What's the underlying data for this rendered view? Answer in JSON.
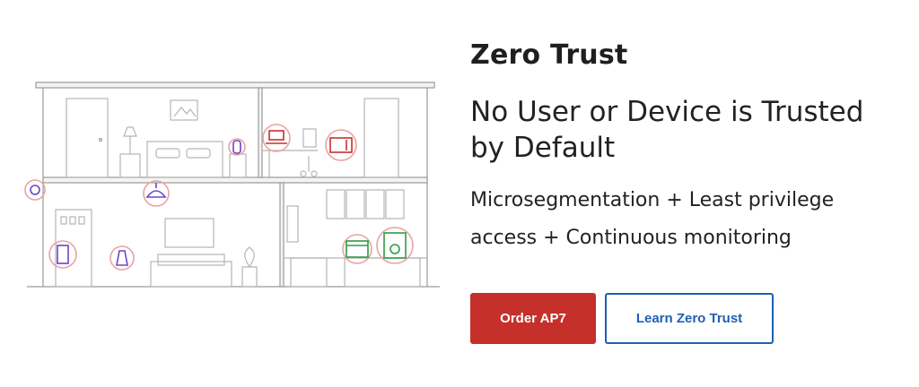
{
  "hero": {
    "title": "Zero Trust",
    "subtitle": "No User or Device is Trusted by Default",
    "description": "Microsegmentation + Least privilege access + Continuous monitoring"
  },
  "actions": {
    "primary_label": "Order AP7",
    "secondary_label": "Learn Zero Trust"
  },
  "illustration": {
    "icons": [
      "house-outline",
      "router-icon",
      "ceiling-lamp-icon",
      "thermostat-icon",
      "smart-speaker-icon",
      "laptop-icon",
      "microwave-icon",
      "smart-plug-icon",
      "oven-icon",
      "coffee-machine-icon"
    ]
  },
  "colors": {
    "primary": "#c6302b",
    "secondary": "#1f5fb4",
    "device_ring": "#e9a3a3",
    "device_purple": "#6c45c9",
    "device_green": "#2e9b47",
    "outline": "#9a9a9a"
  }
}
